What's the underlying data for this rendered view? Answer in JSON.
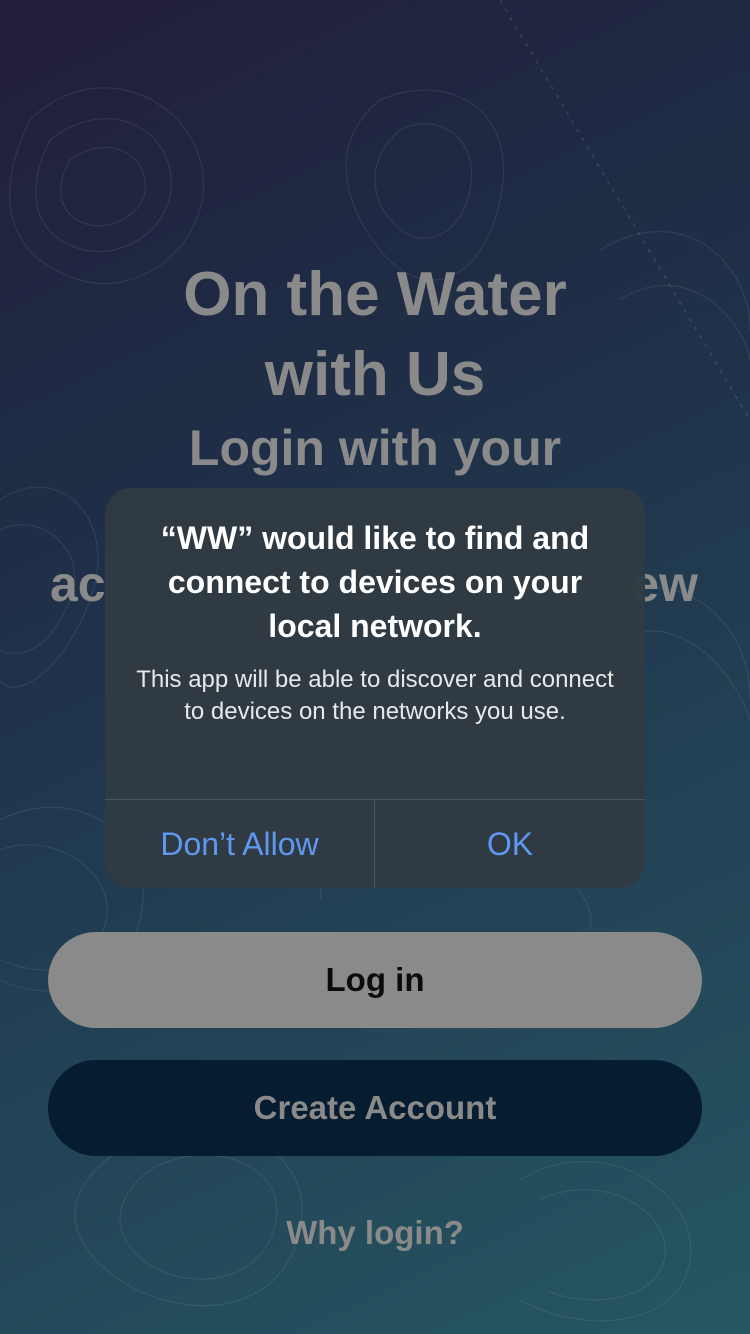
{
  "onboarding": {
    "headline_line1": "On the Water",
    "headline_line2": "with Us",
    "subheadline_line1": "Login with your",
    "subheadline_partial_left": "ac",
    "subheadline_partial_right": "ew",
    "login_label": "Log in",
    "create_account_label": "Create Account",
    "why_login_label": "Why login?"
  },
  "alert": {
    "title": "“WW” would like to find and connect to devices on your local network.",
    "message": "This app will be able to discover and connect to devices on the networks you use.",
    "deny_label": "Don’t Allow",
    "ok_label": "OK"
  },
  "colors": {
    "accent": "#5f98f0",
    "alert_bg": "#303a42",
    "dark_button": "#061c30",
    "muted_text": "#8a8a8a"
  }
}
